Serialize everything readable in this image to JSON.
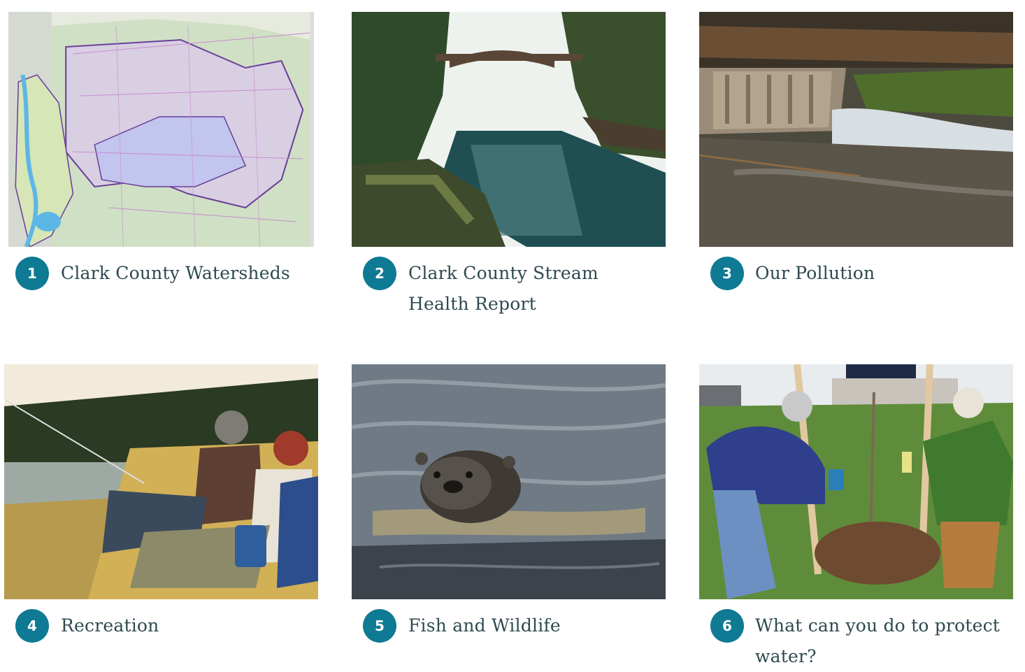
{
  "cards": [
    {
      "number": "1",
      "title": "Clark County Watersheds",
      "image": "clark-county-watershed-map"
    },
    {
      "number": "2",
      "title": "Clark County Stream Health Report",
      "image": "bridge-over-river-gorge"
    },
    {
      "number": "3",
      "title": "Our Pollution",
      "image": "culvert-pipe-stream"
    },
    {
      "number": "4",
      "title": "Recreation",
      "image": "father-son-fishing"
    },
    {
      "number": "5",
      "title": "Fish and Wildlife",
      "image": "river-otter-swimming"
    },
    {
      "number": "6",
      "title": "What can you do to protect water?",
      "image": "people-planting-tree"
    }
  ],
  "colors": {
    "badge": "#0e7a93",
    "title_text": "#2e4a4f",
    "background": "#ffffff"
  }
}
